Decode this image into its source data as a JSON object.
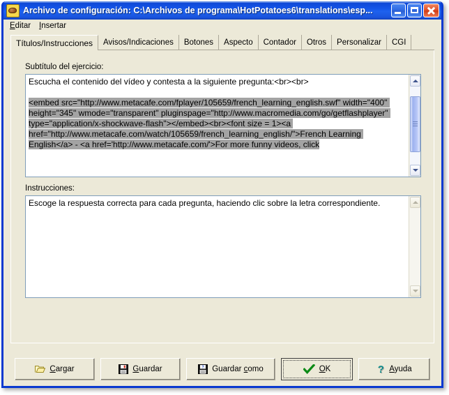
{
  "window": {
    "title": "Archivo de configuración: C:\\Archivos de programa\\HotPotatoes6\\translations\\esp...",
    "icon": "potato-icon",
    "minimize_label": "Minimizar",
    "maximize_label": "Maximizar",
    "close_label": "Cerrar",
    "accent_titlebar": "#0f48d6",
    "face_color": "#ece9d8",
    "border_color": "#0a3ad0"
  },
  "menu": {
    "items": [
      {
        "label": "Editar",
        "accel": "E"
      },
      {
        "label": "Insertar",
        "accel": "I"
      }
    ]
  },
  "tabs": {
    "selected_index": 0,
    "items": [
      {
        "label": "Títulos/Instrucciones"
      },
      {
        "label": "Avisos/Indicaciones"
      },
      {
        "label": "Botones"
      },
      {
        "label": "Aspecto"
      },
      {
        "label": "Contador"
      },
      {
        "label": "Otros"
      },
      {
        "label": "Personalizar"
      },
      {
        "label": "CGI"
      }
    ]
  },
  "fields": {
    "subtitle": {
      "label": "Subtítulo del ejercicio:",
      "line_plain": "Escucha el contenido del vídeo y contesta a la siguiente pregunta:<br><br>",
      "blank_line": "",
      "selected_text": "<embed src=\"http://www.metacafe.com/fplayer/105659/french_learning_english.swf\" width=\"400\" height=\"345\" wmode=\"transparent\" pluginspage=\"http://www.macromedia.com/go/getflashplayer\" type=\"application/x-shockwave-flash\"></embed><br><font size = 1><a href=\"http://www.metacafe.com/watch/105659/french_learning_english/\">French Learning English</a> - <a href='http://www.metacafe.com/'>For more funny videos, click",
      "selection_color": "#a3a3a3",
      "scrollbar": {
        "state": "enabled",
        "thumb_top_pct": 12,
        "thumb_height_pct": 58
      }
    },
    "instructions": {
      "label": "Instrucciones:",
      "value": "Escoge la respuesta correcta para cada pregunta, haciendo clic sobre la letra correspondiente.",
      "scrollbar": {
        "state": "disabled"
      }
    }
  },
  "buttons": [
    {
      "name": "load",
      "label": "Cargar",
      "accel": "C",
      "icon": "open-folder-icon",
      "default": false
    },
    {
      "name": "save",
      "label": "Guardar",
      "accel": "G",
      "icon": "floppy-disk-icon",
      "default": false
    },
    {
      "name": "save-as",
      "label": "Guardar como",
      "accel": "c",
      "icon": "floppy-disk-question-icon",
      "default": false
    },
    {
      "name": "ok",
      "label": "OK",
      "accel": "O",
      "icon": "green-check-icon",
      "default": true
    },
    {
      "name": "help",
      "label": "Ayuda",
      "accel": "A",
      "icon": "question-mark-icon",
      "default": false
    }
  ]
}
